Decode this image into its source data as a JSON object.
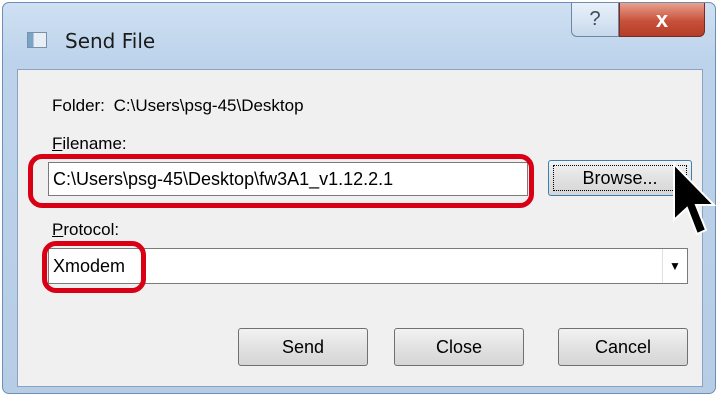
{
  "window": {
    "title": "Send File",
    "help_label": "?",
    "close_label": "x"
  },
  "folder": {
    "label": "Folder:",
    "path": "C:\\Users\\psg-45\\Desktop"
  },
  "filename": {
    "label": "Filename:",
    "value": "C:\\Users\\psg-45\\Desktop\\fw3A1_v1.12.2.1"
  },
  "browse": {
    "label": "Browse..."
  },
  "protocol": {
    "label": "Protocol:",
    "selected": "Xmodem"
  },
  "buttons": {
    "send": "Send",
    "close": "Close",
    "cancel": "Cancel"
  },
  "annotation_color": "#d90016",
  "icons": {
    "window_icon": "window-app-icon",
    "dropdown": "chevron-down-icon",
    "cursor": "mouse-pointer-icon"
  }
}
